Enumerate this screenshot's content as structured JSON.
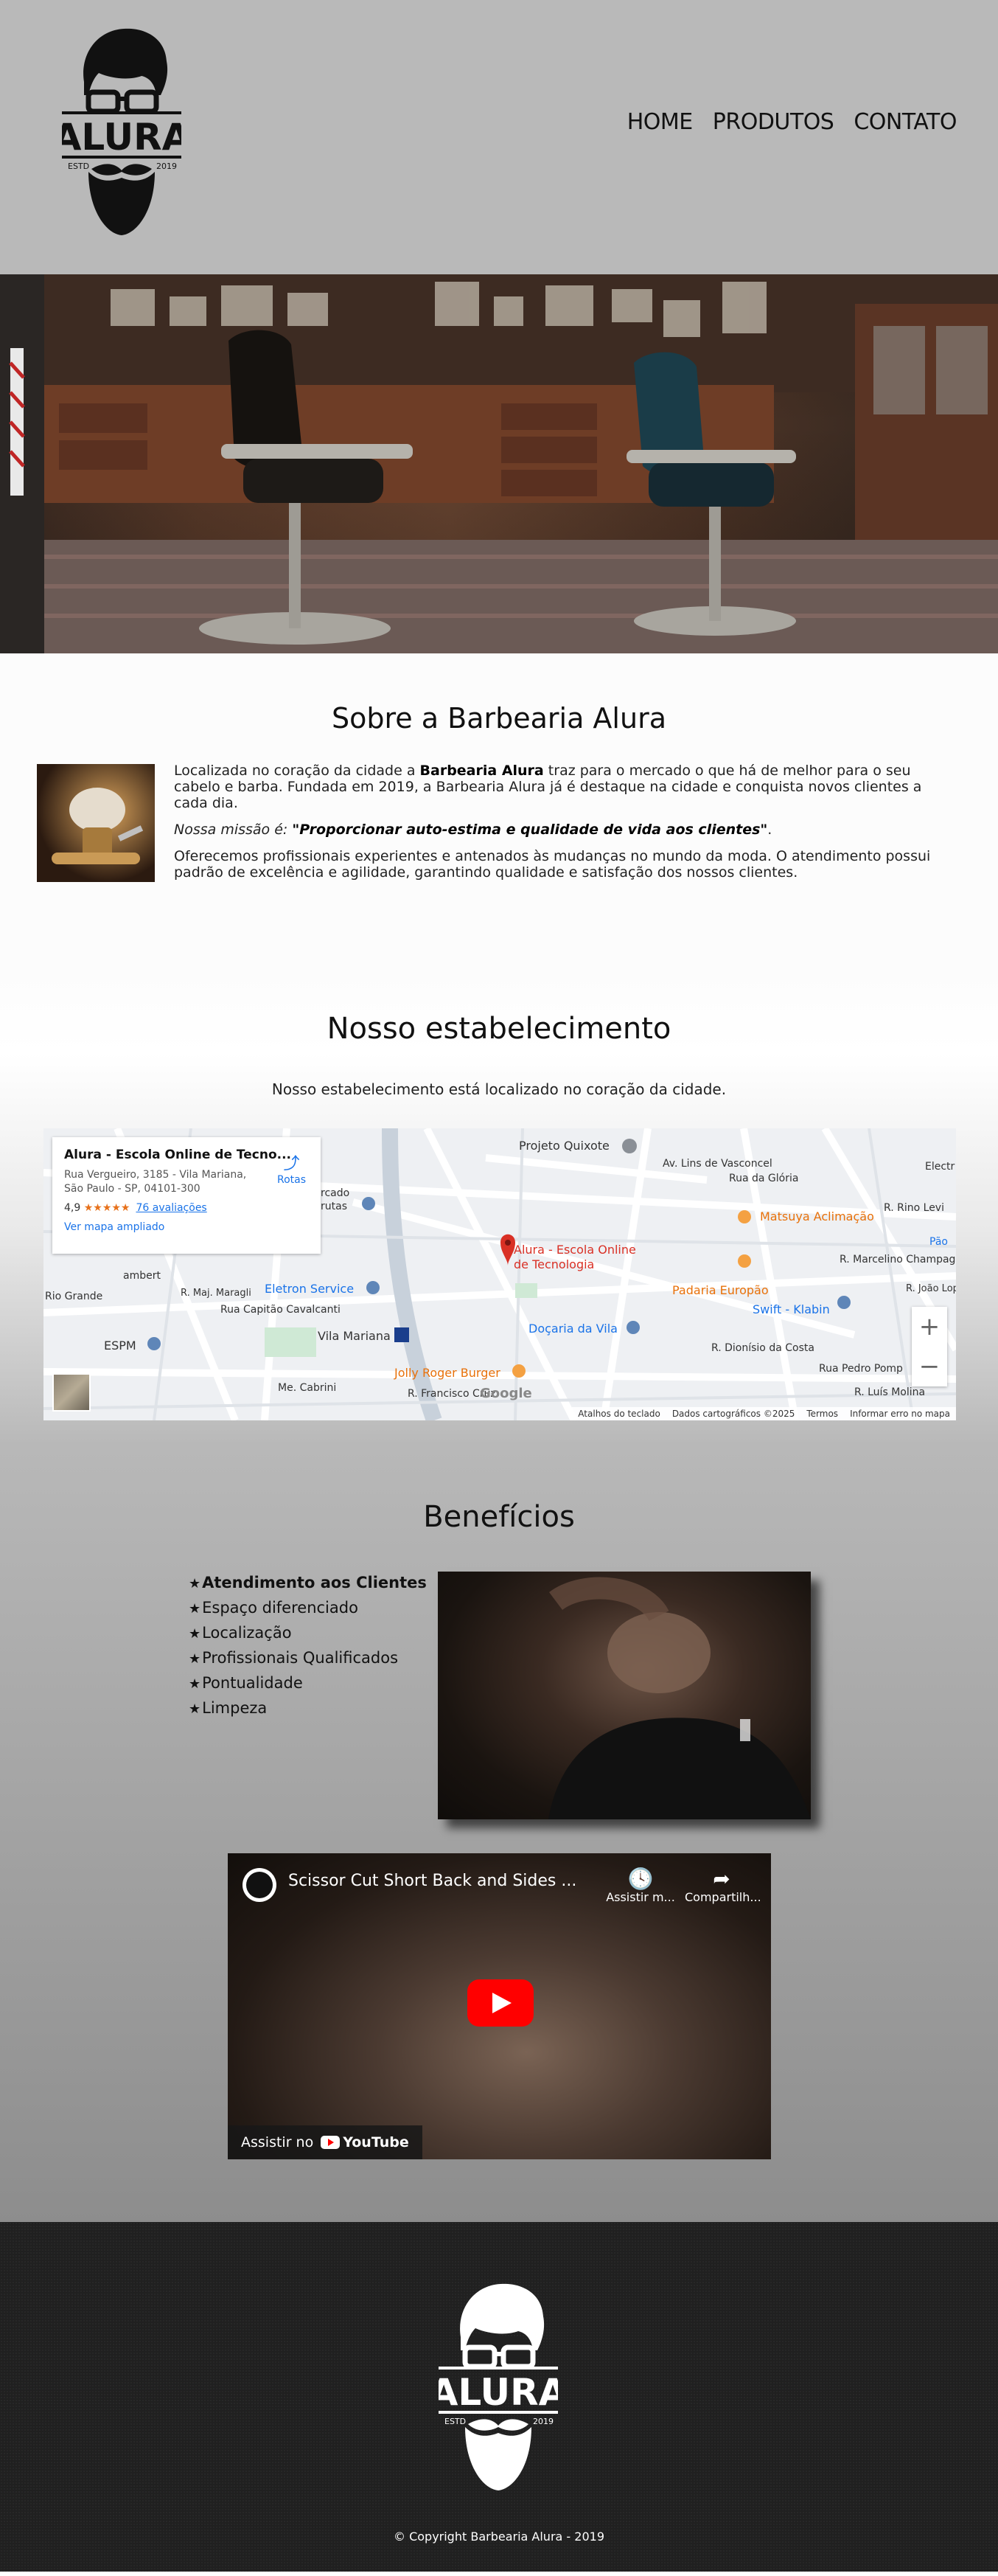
{
  "header": {
    "logo": {
      "brand": "ALURA",
      "esto": "ESTD",
      "year": "2019"
    },
    "nav": [
      {
        "label": "HOME"
      },
      {
        "label": "PRODUTOS"
      },
      {
        "label": "CONTATO"
      }
    ]
  },
  "about": {
    "title": "Sobre a Barbearia Alura",
    "p1_before": "Localizada no coração da cidade a ",
    "p1_bold": "Barbearia Alura",
    "p1_after": " traz para o mercado o que há de melhor para o seu cabelo e barba. Fundada em 2019, a Barbearia Alura já é destaque na cidade e conquista novos clientes a cada dia.",
    "mission_label": "Nossa missão é: ",
    "mission_text": "\"Proporcionar auto-estima e qualidade de vida aos clientes\"",
    "mission_end": ".",
    "p3": "Oferecemos profissionais experientes e antenados às mudanças no mundo da moda. O atendimento possui padrão de excelência e agilidade, garantindo qualidade e satisfação dos nossos clientes."
  },
  "location": {
    "title": "Nosso estabelecimento",
    "subtitle": "Nosso estabelecimento está localizado no coração da cidade.",
    "map": {
      "place_title": "Alura - Escola Online de Tecno...",
      "address_line1": "Rua Vergueiro, 3185 - Vila Mariana,",
      "address_line2": "São Paulo - SP, 04101-300",
      "rating": "4,9",
      "stars": "★★★★★",
      "reviews": "76 avaliações",
      "larger_map": "Ver mapa ampliado",
      "directions": "Rotas",
      "pin_label_1": "Alura - Escola Online",
      "pin_label_2": "de Tecnologia",
      "labels": {
        "projeto_quixote": "Projeto Quixote",
        "matsuya": "Matsuya Aclimação",
        "padaria": "Padaria Europão",
        "swift": "Swift - Klabin",
        "eletron": "Eletron Service",
        "vila_mariana": "Vila Mariana",
        "docaria": "Doçaria da Vila",
        "jolly": "Jolly Roger Burger",
        "espm": "ESPM",
        "cavalcanti": "Rua Capitão Cavalcanti",
        "francisco": "R. Francisco Cruz",
        "dionisio": "R. Dionísio da Costa",
        "pedro": "Rua Pedro Pomp",
        "luis": "R. Luís Molina",
        "rio_levi": "R. Rino Levi",
        "marcelino": "R. Marcelino Champag",
        "joao": "R. João Lopes",
        "vasconcelos": "Av. Lins de Vasconcel",
        "gloria": "Rua da Glória",
        "electro": "Electr",
        "pao": "Pão",
        "mercado": "rcado",
        "frutas": "rutas",
        "rio_grande": "Rio Grande",
        "ambert": "ambert",
        "mai": "R. Maj. Maragli",
        "cabrini": "Me. Cabrini"
      },
      "footer": {
        "keyboard": "Atalhos do teclado",
        "data": "Dados cartográficos ©2025",
        "terms": "Termos",
        "report": "Informar erro no mapa"
      },
      "zoom_in": "+",
      "zoom_out": "−",
      "google": "Google"
    }
  },
  "benefits": {
    "title": "Benefícios",
    "items": [
      "Atendimento aos Clientes",
      "Espaço diferenciado",
      "Localização",
      "Profissionais Qualificados",
      "Pontualidade",
      "Limpeza"
    ],
    "video": {
      "title": "Scissor Cut Short Back and Sides ...",
      "watch_later": "Assistir m...",
      "share": "Compartilh...",
      "watch_on": "Assistir no",
      "youtube": "YouTube"
    }
  },
  "footer": {
    "logo": {
      "brand": "ALURA",
      "esto": "ESTD",
      "year": "2019"
    },
    "copyright": "© Copyright Barbearia Alura - 2019"
  },
  "colors": {
    "header_bg": "#b9b9b9",
    "footer_bg": "#202020",
    "youtube_red": "#ff0000",
    "link_blue": "#1a73e8"
  }
}
